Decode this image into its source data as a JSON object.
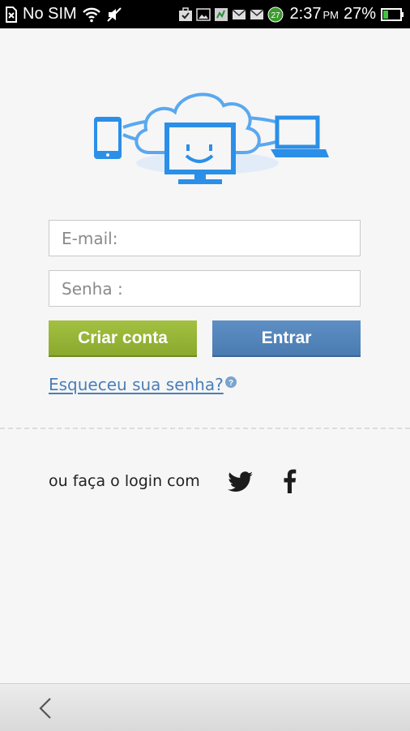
{
  "status_bar": {
    "carrier": "No SIM",
    "notification_badge": "27",
    "time": "2:37",
    "ampm": "PM",
    "battery": "27%"
  },
  "login": {
    "email_placeholder": "E-mail:",
    "password_placeholder": "Senha :",
    "create_account_label": "Criar conta",
    "login_label": "Entrar",
    "forgot_password_label": "Esqueceu sua senha?"
  },
  "social": {
    "text": "ou faça o login com",
    "icons": [
      "twitter-icon",
      "facebook-icon"
    ]
  },
  "colors": {
    "accent_blue": "#4a7bb1",
    "accent_green": "#8aa92e",
    "link": "#4a7fb8",
    "hero_blue": "#2b8fe8",
    "status_bar": "#000000"
  }
}
